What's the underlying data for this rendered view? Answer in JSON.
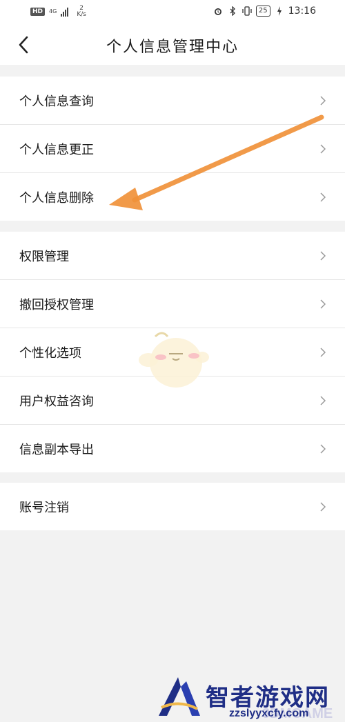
{
  "status_bar": {
    "hd": "HD",
    "network": "4G",
    "speed_value": "2",
    "speed_unit": "K/s",
    "battery": "25",
    "time": "13:16"
  },
  "header": {
    "title": "个人信息管理中心",
    "back_icon": "chevron-left-icon"
  },
  "groups": [
    {
      "items": [
        {
          "label": "个人信息查询",
          "icon": "chevron-right-icon"
        },
        {
          "label": "个人信息更正",
          "icon": "chevron-right-icon"
        },
        {
          "label": "个人信息删除",
          "icon": "chevron-right-icon"
        }
      ]
    },
    {
      "items": [
        {
          "label": "权限管理",
          "icon": "chevron-right-icon"
        },
        {
          "label": "撤回授权管理",
          "icon": "chevron-right-icon"
        },
        {
          "label": "个性化选项",
          "icon": "chevron-right-icon"
        },
        {
          "label": "用户权益咨询",
          "icon": "chevron-right-icon"
        },
        {
          "label": "信息副本导出",
          "icon": "chevron-right-icon"
        }
      ]
    },
    {
      "items": [
        {
          "label": "账号注销",
          "icon": "chevron-right-icon"
        }
      ]
    }
  ],
  "watermark": {
    "title": "智者游戏网",
    "url": "zzslyyxcfy.com",
    "overlay_text": "3DMGAME"
  },
  "colors": {
    "annotation_arrow": "#f0913a",
    "background": "#f2f2f2",
    "row_background": "#ffffff",
    "watermark_brand": "#1f2e86"
  }
}
